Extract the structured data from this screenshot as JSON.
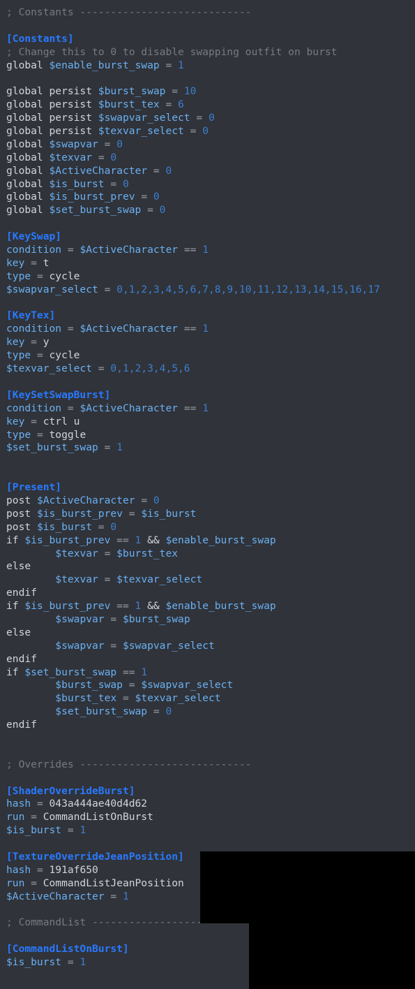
{
  "editor": {
    "language": "ini",
    "background_color": "#303339",
    "colors": {
      "comment": "#777b82",
      "section_header": "#2979ff",
      "key": "#6ab0f3",
      "variable": "#6ab0f3",
      "number": "#3d7fd0",
      "operator": "#9ba0a8",
      "plain_text": "#d2d5da",
      "overlay": "#000000"
    },
    "lines": [
      {
        "n": 1,
        "tokens": [
          {
            "t": "; Constants ----------------------------",
            "c": "c-comment"
          }
        ]
      },
      {
        "n": 2,
        "tokens": []
      },
      {
        "n": 3,
        "tokens": [
          {
            "t": "[Constants]",
            "c": "c-section"
          }
        ]
      },
      {
        "n": 4,
        "tokens": [
          {
            "t": "; Change this to 0 to disable swapping outfit on burst",
            "c": "c-comment"
          }
        ]
      },
      {
        "n": 5,
        "tokens": [
          {
            "t": "global ",
            "c": "c-kw"
          },
          {
            "t": "$enable_burst_swap",
            "c": "c-var"
          },
          {
            "t": " = ",
            "c": "c-op"
          },
          {
            "t": "1",
            "c": "c-num"
          }
        ]
      },
      {
        "n": 6,
        "tokens": []
      },
      {
        "n": 7,
        "tokens": [
          {
            "t": "global persist ",
            "c": "c-kw"
          },
          {
            "t": "$burst_swap",
            "c": "c-var"
          },
          {
            "t": " = ",
            "c": "c-op"
          },
          {
            "t": "10",
            "c": "c-num"
          }
        ]
      },
      {
        "n": 8,
        "tokens": [
          {
            "t": "global persist ",
            "c": "c-kw"
          },
          {
            "t": "$burst_tex",
            "c": "c-var"
          },
          {
            "t": " = ",
            "c": "c-op"
          },
          {
            "t": "6",
            "c": "c-num"
          }
        ]
      },
      {
        "n": 9,
        "tokens": [
          {
            "t": "global persist ",
            "c": "c-kw"
          },
          {
            "t": "$swapvar_select",
            "c": "c-var"
          },
          {
            "t": " = ",
            "c": "c-op"
          },
          {
            "t": "0",
            "c": "c-num"
          }
        ]
      },
      {
        "n": 10,
        "tokens": [
          {
            "t": "global persist ",
            "c": "c-kw"
          },
          {
            "t": "$texvar_select",
            "c": "c-var"
          },
          {
            "t": " = ",
            "c": "c-op"
          },
          {
            "t": "0",
            "c": "c-num"
          }
        ]
      },
      {
        "n": 11,
        "tokens": [
          {
            "t": "global ",
            "c": "c-kw"
          },
          {
            "t": "$swapvar",
            "c": "c-var"
          },
          {
            "t": " = ",
            "c": "c-op"
          },
          {
            "t": "0",
            "c": "c-num"
          }
        ]
      },
      {
        "n": 12,
        "tokens": [
          {
            "t": "global ",
            "c": "c-kw"
          },
          {
            "t": "$texvar",
            "c": "c-var"
          },
          {
            "t": " = ",
            "c": "c-op"
          },
          {
            "t": "0",
            "c": "c-num"
          }
        ]
      },
      {
        "n": 13,
        "tokens": [
          {
            "t": "global ",
            "c": "c-kw"
          },
          {
            "t": "$ActiveCharacter",
            "c": "c-var"
          },
          {
            "t": " = ",
            "c": "c-op"
          },
          {
            "t": "0",
            "c": "c-num"
          }
        ]
      },
      {
        "n": 14,
        "tokens": [
          {
            "t": "global ",
            "c": "c-kw"
          },
          {
            "t": "$is_burst",
            "c": "c-var"
          },
          {
            "t": " = ",
            "c": "c-op"
          },
          {
            "t": "0",
            "c": "c-num"
          }
        ]
      },
      {
        "n": 15,
        "tokens": [
          {
            "t": "global ",
            "c": "c-kw"
          },
          {
            "t": "$is_burst_prev",
            "c": "c-var"
          },
          {
            "t": " = ",
            "c": "c-op"
          },
          {
            "t": "0",
            "c": "c-num"
          }
        ]
      },
      {
        "n": 16,
        "tokens": [
          {
            "t": "global ",
            "c": "c-kw"
          },
          {
            "t": "$set_burst_swap",
            "c": "c-var"
          },
          {
            "t": " = ",
            "c": "c-op"
          },
          {
            "t": "0",
            "c": "c-num"
          }
        ]
      },
      {
        "n": 17,
        "tokens": []
      },
      {
        "n": 18,
        "tokens": [
          {
            "t": "[KeySwap]",
            "c": "c-section"
          }
        ]
      },
      {
        "n": 19,
        "tokens": [
          {
            "t": "condition",
            "c": "c-key"
          },
          {
            "t": " = ",
            "c": "c-op"
          },
          {
            "t": "$ActiveCharacter",
            "c": "c-var"
          },
          {
            "t": " == ",
            "c": "c-op"
          },
          {
            "t": "1",
            "c": "c-num"
          }
        ]
      },
      {
        "n": 20,
        "tokens": [
          {
            "t": "key",
            "c": "c-key"
          },
          {
            "t": " = ",
            "c": "c-op"
          },
          {
            "t": "t",
            "c": "c-val"
          }
        ]
      },
      {
        "n": 21,
        "tokens": [
          {
            "t": "type",
            "c": "c-key"
          },
          {
            "t": " = ",
            "c": "c-op"
          },
          {
            "t": "cycle",
            "c": "c-val"
          }
        ]
      },
      {
        "n": 22,
        "tokens": [
          {
            "t": "$swapvar_select",
            "c": "c-var"
          },
          {
            "t": " = ",
            "c": "c-op"
          },
          {
            "t": "0,1,2,3,4,5,6,7,8,9,10,11,12,13,14,15,16,17",
            "c": "c-num"
          }
        ]
      },
      {
        "n": 23,
        "tokens": []
      },
      {
        "n": 24,
        "tokens": [
          {
            "t": "[KeyTex]",
            "c": "c-section"
          }
        ]
      },
      {
        "n": 25,
        "tokens": [
          {
            "t": "condition",
            "c": "c-key"
          },
          {
            "t": " = ",
            "c": "c-op"
          },
          {
            "t": "$ActiveCharacter",
            "c": "c-var"
          },
          {
            "t": " == ",
            "c": "c-op"
          },
          {
            "t": "1",
            "c": "c-num"
          }
        ]
      },
      {
        "n": 26,
        "tokens": [
          {
            "t": "key",
            "c": "c-key"
          },
          {
            "t": " = ",
            "c": "c-op"
          },
          {
            "t": "y",
            "c": "c-val"
          }
        ]
      },
      {
        "n": 27,
        "tokens": [
          {
            "t": "type",
            "c": "c-key"
          },
          {
            "t": " = ",
            "c": "c-op"
          },
          {
            "t": "cycle",
            "c": "c-val"
          }
        ]
      },
      {
        "n": 28,
        "tokens": [
          {
            "t": "$texvar_select",
            "c": "c-var"
          },
          {
            "t": " = ",
            "c": "c-op"
          },
          {
            "t": "0,1,2,3,4,5,6",
            "c": "c-num"
          }
        ]
      },
      {
        "n": 29,
        "tokens": []
      },
      {
        "n": 30,
        "tokens": [
          {
            "t": "[KeySetSwapBurst]",
            "c": "c-section"
          }
        ]
      },
      {
        "n": 31,
        "tokens": [
          {
            "t": "condition",
            "c": "c-key"
          },
          {
            "t": " = ",
            "c": "c-op"
          },
          {
            "t": "$ActiveCharacter",
            "c": "c-var"
          },
          {
            "t": " == ",
            "c": "c-op"
          },
          {
            "t": "1",
            "c": "c-num"
          }
        ]
      },
      {
        "n": 32,
        "tokens": [
          {
            "t": "key",
            "c": "c-key"
          },
          {
            "t": " = ",
            "c": "c-op"
          },
          {
            "t": "ctrl u",
            "c": "c-val"
          }
        ]
      },
      {
        "n": 33,
        "tokens": [
          {
            "t": "type",
            "c": "c-key"
          },
          {
            "t": " = ",
            "c": "c-op"
          },
          {
            "t": "toggle",
            "c": "c-val"
          }
        ]
      },
      {
        "n": 34,
        "tokens": [
          {
            "t": "$set_burst_swap",
            "c": "c-var"
          },
          {
            "t": " = ",
            "c": "c-op"
          },
          {
            "t": "1",
            "c": "c-num"
          }
        ]
      },
      {
        "n": 35,
        "tokens": []
      },
      {
        "n": 36,
        "tokens": []
      },
      {
        "n": 37,
        "tokens": [
          {
            "t": "[Present]",
            "c": "c-section"
          }
        ]
      },
      {
        "n": 38,
        "tokens": [
          {
            "t": "post ",
            "c": "c-kw"
          },
          {
            "t": "$ActiveCharacter",
            "c": "c-var"
          },
          {
            "t": " = ",
            "c": "c-op"
          },
          {
            "t": "0",
            "c": "c-num"
          }
        ]
      },
      {
        "n": 39,
        "tokens": [
          {
            "t": "post ",
            "c": "c-kw"
          },
          {
            "t": "$is_burst_prev",
            "c": "c-var"
          },
          {
            "t": " = ",
            "c": "c-op"
          },
          {
            "t": "$is_burst",
            "c": "c-var"
          }
        ]
      },
      {
        "n": 40,
        "tokens": [
          {
            "t": "post ",
            "c": "c-kw"
          },
          {
            "t": "$is_burst",
            "c": "c-var"
          },
          {
            "t": " = ",
            "c": "c-op"
          },
          {
            "t": "0",
            "c": "c-num"
          }
        ]
      },
      {
        "n": 41,
        "tokens": [
          {
            "t": "if ",
            "c": "c-kw"
          },
          {
            "t": "$is_burst_prev",
            "c": "c-var"
          },
          {
            "t": " == ",
            "c": "c-op"
          },
          {
            "t": "1",
            "c": "c-num"
          },
          {
            "t": " && ",
            "c": "c-kw"
          },
          {
            "t": "$enable_burst_swap",
            "c": "c-var"
          }
        ]
      },
      {
        "n": 42,
        "tokens": [
          {
            "t": "        ",
            "c": "c-plain"
          },
          {
            "t": "$texvar",
            "c": "c-var"
          },
          {
            "t": " = ",
            "c": "c-op"
          },
          {
            "t": "$burst_tex",
            "c": "c-var"
          }
        ]
      },
      {
        "n": 43,
        "tokens": [
          {
            "t": "else",
            "c": "c-kw"
          }
        ]
      },
      {
        "n": 44,
        "tokens": [
          {
            "t": "        ",
            "c": "c-plain"
          },
          {
            "t": "$texvar",
            "c": "c-var"
          },
          {
            "t": " = ",
            "c": "c-op"
          },
          {
            "t": "$texvar_select",
            "c": "c-var"
          }
        ]
      },
      {
        "n": 45,
        "tokens": [
          {
            "t": "endif",
            "c": "c-kw"
          }
        ]
      },
      {
        "n": 46,
        "tokens": [
          {
            "t": "if ",
            "c": "c-kw"
          },
          {
            "t": "$is_burst_prev",
            "c": "c-var"
          },
          {
            "t": " == ",
            "c": "c-op"
          },
          {
            "t": "1",
            "c": "c-num"
          },
          {
            "t": " && ",
            "c": "c-kw"
          },
          {
            "t": "$enable_burst_swap",
            "c": "c-var"
          }
        ]
      },
      {
        "n": 47,
        "tokens": [
          {
            "t": "        ",
            "c": "c-plain"
          },
          {
            "t": "$swapvar",
            "c": "c-var"
          },
          {
            "t": " = ",
            "c": "c-op"
          },
          {
            "t": "$burst_swap",
            "c": "c-var"
          }
        ]
      },
      {
        "n": 48,
        "tokens": [
          {
            "t": "else",
            "c": "c-kw"
          }
        ]
      },
      {
        "n": 49,
        "tokens": [
          {
            "t": "        ",
            "c": "c-plain"
          },
          {
            "t": "$swapvar",
            "c": "c-var"
          },
          {
            "t": " = ",
            "c": "c-op"
          },
          {
            "t": "$swapvar_select",
            "c": "c-var"
          }
        ]
      },
      {
        "n": 50,
        "tokens": [
          {
            "t": "endif",
            "c": "c-kw"
          }
        ]
      },
      {
        "n": 51,
        "tokens": [
          {
            "t": "if ",
            "c": "c-kw"
          },
          {
            "t": "$set_burst_swap",
            "c": "c-var"
          },
          {
            "t": " == ",
            "c": "c-op"
          },
          {
            "t": "1",
            "c": "c-num"
          }
        ]
      },
      {
        "n": 52,
        "tokens": [
          {
            "t": "        ",
            "c": "c-plain"
          },
          {
            "t": "$burst_swap",
            "c": "c-var"
          },
          {
            "t": " = ",
            "c": "c-op"
          },
          {
            "t": "$swapvar_select",
            "c": "c-var"
          }
        ]
      },
      {
        "n": 53,
        "tokens": [
          {
            "t": "        ",
            "c": "c-plain"
          },
          {
            "t": "$burst_tex",
            "c": "c-var"
          },
          {
            "t": " = ",
            "c": "c-op"
          },
          {
            "t": "$texvar_select",
            "c": "c-var"
          }
        ]
      },
      {
        "n": 54,
        "tokens": [
          {
            "t": "        ",
            "c": "c-plain"
          },
          {
            "t": "$set_burst_swap",
            "c": "c-var"
          },
          {
            "t": " = ",
            "c": "c-op"
          },
          {
            "t": "0",
            "c": "c-num"
          }
        ]
      },
      {
        "n": 55,
        "tokens": [
          {
            "t": "endif",
            "c": "c-kw"
          }
        ]
      },
      {
        "n": 56,
        "tokens": []
      },
      {
        "n": 57,
        "tokens": []
      },
      {
        "n": 58,
        "tokens": [
          {
            "t": "; Overrides ----------------------------",
            "c": "c-comment"
          }
        ]
      },
      {
        "n": 59,
        "tokens": []
      },
      {
        "n": 60,
        "tokens": [
          {
            "t": "[ShaderOverrideBurst]",
            "c": "c-section"
          }
        ]
      },
      {
        "n": 61,
        "tokens": [
          {
            "t": "hash",
            "c": "c-key"
          },
          {
            "t": " = ",
            "c": "c-op"
          },
          {
            "t": "043a444ae40d4d62",
            "c": "c-val"
          }
        ]
      },
      {
        "n": 62,
        "tokens": [
          {
            "t": "run",
            "c": "c-key"
          },
          {
            "t": " = ",
            "c": "c-op"
          },
          {
            "t": "CommandListOnBurst",
            "c": "c-val"
          }
        ]
      },
      {
        "n": 63,
        "tokens": [
          {
            "t": "$is_burst",
            "c": "c-var"
          },
          {
            "t": " = ",
            "c": "c-op"
          },
          {
            "t": "1",
            "c": "c-num"
          }
        ]
      },
      {
        "n": 64,
        "tokens": []
      },
      {
        "n": 65,
        "tokens": [
          {
            "t": "[TextureOverrideJeanPosition]",
            "c": "c-section"
          }
        ]
      },
      {
        "n": 66,
        "tokens": [
          {
            "t": "hash",
            "c": "c-key"
          },
          {
            "t": " = ",
            "c": "c-op"
          },
          {
            "t": "191af650",
            "c": "c-val"
          }
        ]
      },
      {
        "n": 67,
        "tokens": [
          {
            "t": "run",
            "c": "c-key"
          },
          {
            "t": " = ",
            "c": "c-op"
          },
          {
            "t": "CommandListJeanPosition",
            "c": "c-val"
          }
        ]
      },
      {
        "n": 68,
        "tokens": [
          {
            "t": "$ActiveCharacter",
            "c": "c-var"
          },
          {
            "t": " = ",
            "c": "c-op"
          },
          {
            "t": "1",
            "c": "c-num"
          }
        ]
      },
      {
        "n": 69,
        "tokens": []
      },
      {
        "n": 70,
        "tokens": [
          {
            "t": "; CommandList ----------------------------",
            "c": "c-comment"
          }
        ]
      },
      {
        "n": 71,
        "tokens": []
      },
      {
        "n": 72,
        "tokens": [
          {
            "t": "[CommandListOnBurst]",
            "c": "c-section"
          }
        ]
      },
      {
        "n": 73,
        "tokens": [
          {
            "t": "$is_burst",
            "c": "c-var"
          },
          {
            "t": " = ",
            "c": "c-op"
          },
          {
            "t": "1",
            "c": "c-num"
          }
        ]
      }
    ]
  }
}
